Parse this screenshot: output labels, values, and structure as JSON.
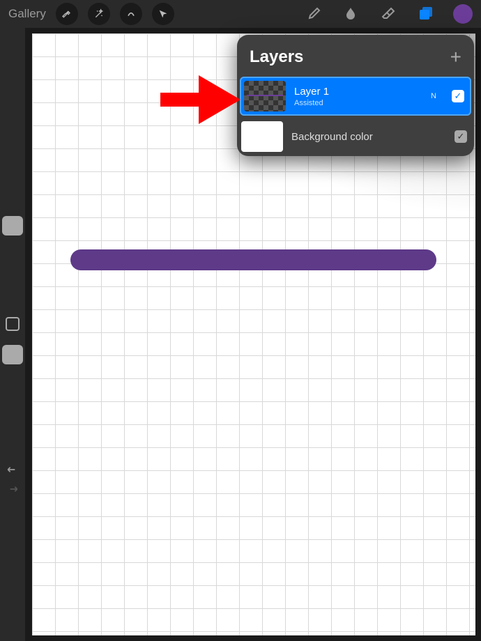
{
  "toolbar": {
    "gallery_label": "Gallery",
    "icons": {
      "wrench": "wrench-icon",
      "wand": "wand-icon",
      "selection": "selection-icon",
      "transform": "arrow-icon",
      "brush": "brush-icon",
      "smudge": "smudge-icon",
      "eraser": "eraser-icon",
      "layers": "layers-icon"
    },
    "color_swatch": "#6b3d99"
  },
  "layers_panel": {
    "title": "Layers",
    "add_label": "+",
    "layers": [
      {
        "name": "Layer 1",
        "subtitle": "Assisted",
        "blend_mode": "N",
        "selected": true,
        "visible": true
      },
      {
        "name": "Background color",
        "selected": false,
        "visible": true
      }
    ]
  },
  "canvas": {
    "stroke_color": "#5e3a89"
  }
}
